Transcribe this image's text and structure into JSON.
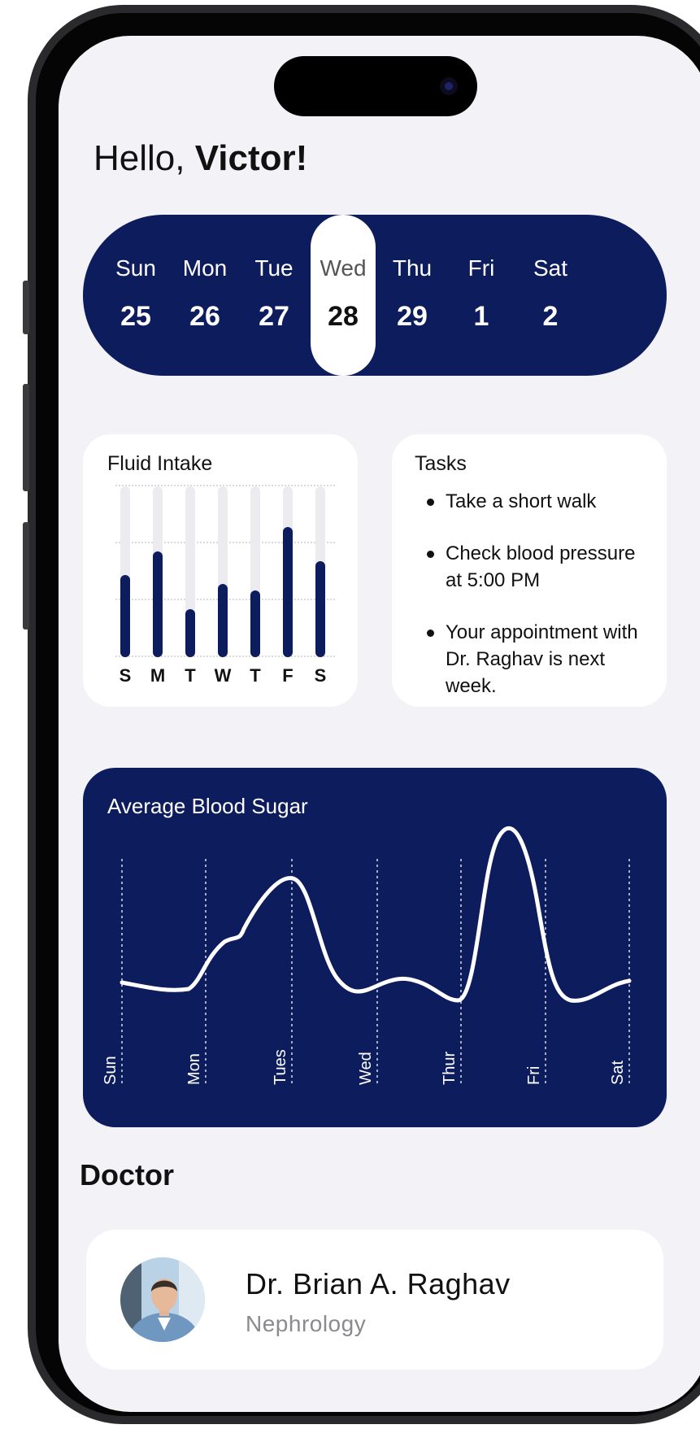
{
  "greeting": {
    "prefix": "Hello,",
    "name": "Victor!"
  },
  "week": {
    "selected_index": 3,
    "days": [
      {
        "name": "Sun",
        "num": "25"
      },
      {
        "name": "Mon",
        "num": "26"
      },
      {
        "name": "Tue",
        "num": "27"
      },
      {
        "name": "Wed",
        "num": "28"
      },
      {
        "name": "Thu",
        "num": "29"
      },
      {
        "name": "Fri",
        "num": "1"
      },
      {
        "name": "Sat",
        "num": "2"
      }
    ]
  },
  "fluid_intake": {
    "title": "Fluid Intake",
    "labels": [
      "S",
      "M",
      "T",
      "W",
      "T",
      "F",
      "S"
    ],
    "fill_fractions": [
      0.48,
      0.62,
      0.28,
      0.43,
      0.39,
      0.76,
      0.56
    ]
  },
  "tasks": {
    "title": "Tasks",
    "items": [
      "Take a short walk",
      "Check blood pressure at 5:00 PM",
      "Your appointment with Dr. Raghav is next week."
    ]
  },
  "blood_sugar": {
    "title": "Average Blood Sugar",
    "days": [
      "Sun",
      "Mon",
      "Tues",
      "Wed",
      "Thur",
      "Fri",
      "Sat"
    ]
  },
  "doctor": {
    "heading": "Doctor",
    "name": "Dr. Brian A. Raghav",
    "specialty": "Nephrology"
  },
  "colors": {
    "navy": "#0c1c5c",
    "background": "#f2f2f7",
    "card": "#ffffff"
  },
  "icons": {
    "avatar": "doctor-avatar-photo"
  }
}
